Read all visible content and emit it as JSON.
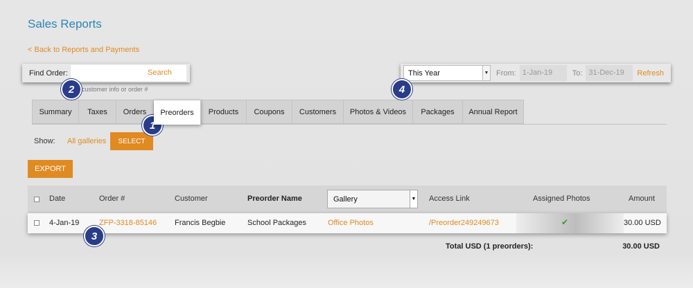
{
  "page": {
    "title": "Sales Reports",
    "back_link": "< Back to Reports and Payments"
  },
  "find_order": {
    "label": "Find Order:",
    "value": "",
    "search_label": "Search",
    "hint": "customer info or order #"
  },
  "filter": {
    "period": "This Year",
    "from_label": "From:",
    "from_value": "1-Jan-19",
    "to_label": "To:",
    "to_value": "31-Dec-19",
    "refresh_label": "Refresh"
  },
  "tabs": [
    {
      "label": "Summary",
      "active": false
    },
    {
      "label": "Taxes",
      "active": false
    },
    {
      "label": "Orders",
      "active": false
    },
    {
      "label": "Preorders",
      "active": true
    },
    {
      "label": "Products",
      "active": false
    },
    {
      "label": "Coupons",
      "active": false
    },
    {
      "label": "Customers",
      "active": false
    },
    {
      "label": "Photos & Videos",
      "active": false
    },
    {
      "label": "Packages",
      "active": false
    },
    {
      "label": "Annual Report",
      "active": false
    }
  ],
  "show": {
    "label": "Show:",
    "value": "All galleries",
    "select_label": "SELECT"
  },
  "export_label": "EXPORT",
  "table": {
    "headers": {
      "date": "Date",
      "order": "Order #",
      "customer": "Customer",
      "preorder_name": "Preorder Name",
      "gallery": "Gallery",
      "access_link": "Access Link",
      "assigned_photos": "Assigned Photos",
      "amount": "Amount"
    },
    "rows": [
      {
        "date": "4-Jan-19",
        "order": "ZFP-3318-85146",
        "customer": "Francis Begbie",
        "preorder_name": "School Packages",
        "gallery": "Office Photos",
        "access_link": "/Preorder249249673",
        "assigned_photos_icon": "check-icon",
        "amount": "30.00 USD"
      }
    ],
    "total_label": "Total USD (1 preorders):",
    "total_value": "30.00 USD"
  },
  "badges": [
    "1",
    "2",
    "3",
    "4"
  ],
  "colors": {
    "accent": "#e08a22",
    "title": "#2a86b4",
    "badge": "#2a3d8a",
    "check": "#3a9a2a"
  }
}
